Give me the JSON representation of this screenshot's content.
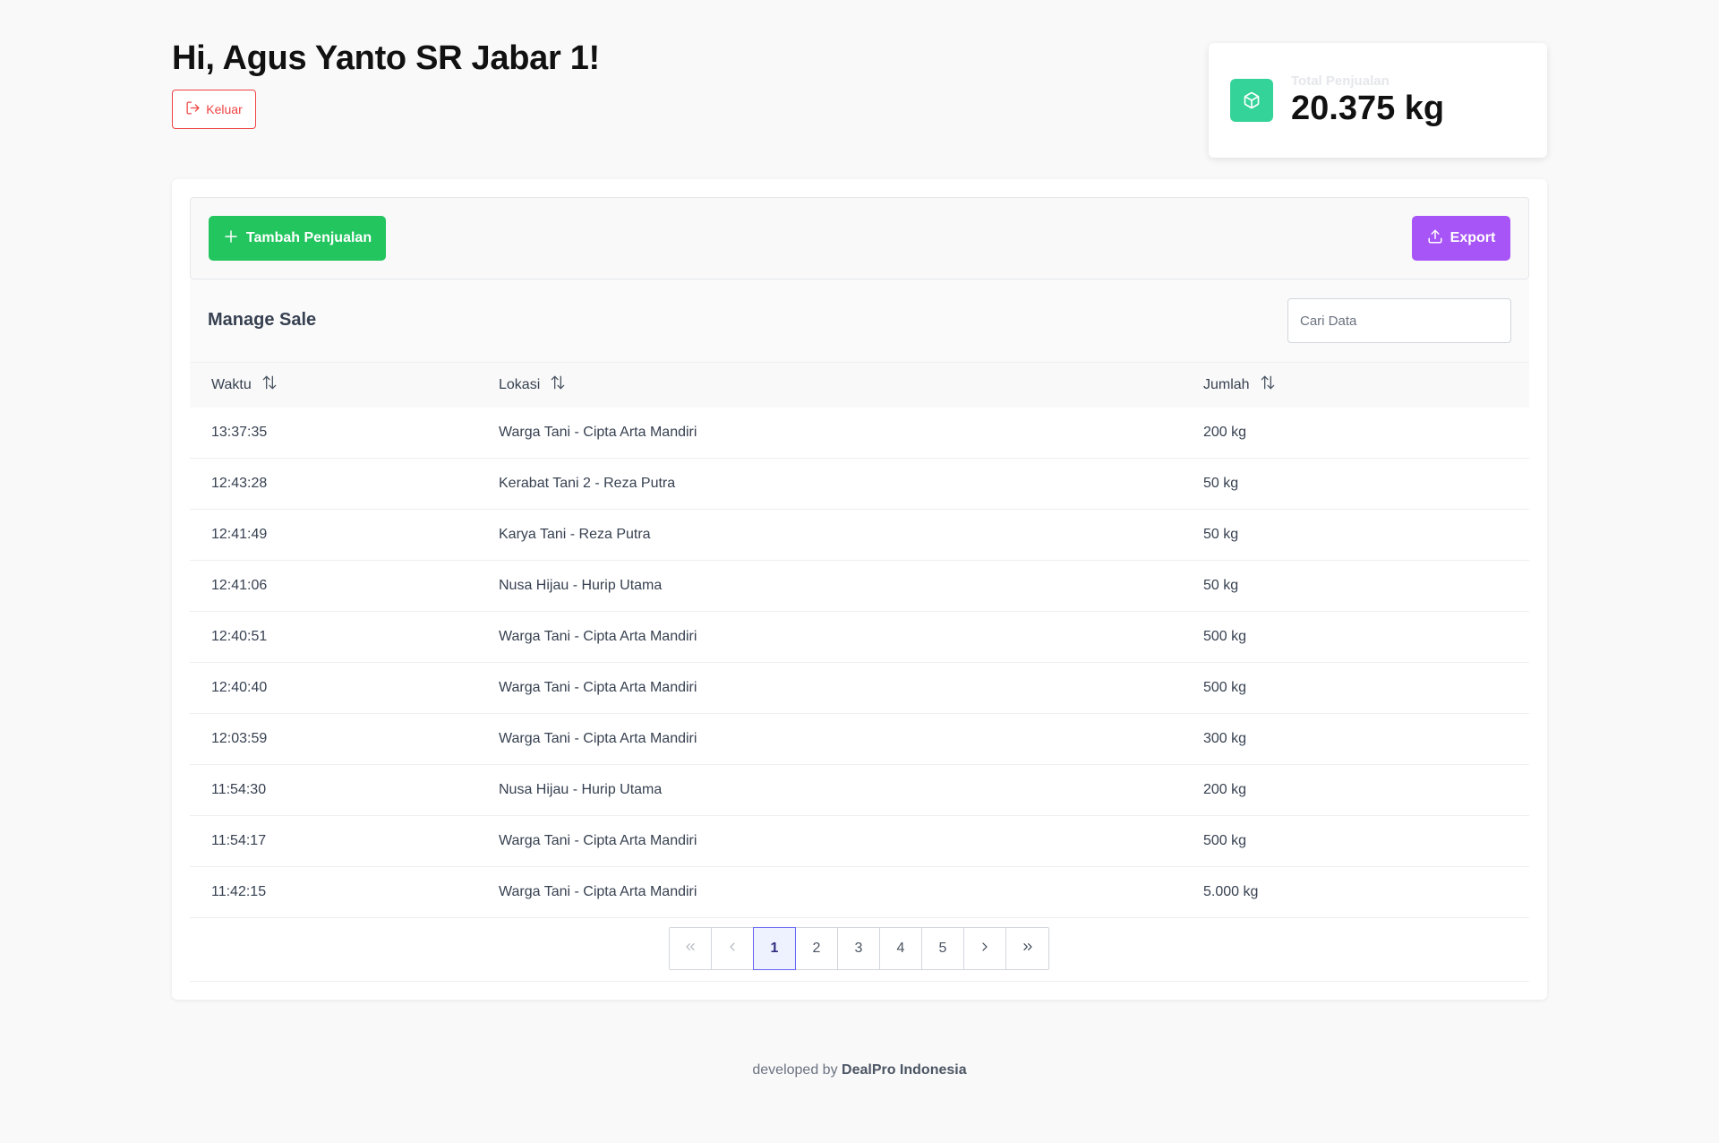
{
  "header": {
    "greeting": "Hi, Agus Yanto SR Jabar 1!",
    "logout_label": "Keluar"
  },
  "stats": {
    "label": "Total Penjualan",
    "value": "20.375 kg",
    "icon": "cube-icon",
    "accent_color": "#34d399"
  },
  "toolbar": {
    "add_label": "Tambah Penjualan",
    "export_label": "Export",
    "add_color": "#22c55e",
    "export_color": "#a855f7"
  },
  "table": {
    "title": "Manage Sale",
    "search_placeholder": "Cari Data",
    "columns": [
      "Waktu",
      "Lokasi",
      "Jumlah"
    ],
    "rows": [
      {
        "waktu": "13:37:35",
        "lokasi": "Warga Tani - Cipta Arta Mandiri",
        "jumlah": "200 kg"
      },
      {
        "waktu": "12:43:28",
        "lokasi": "Kerabat Tani 2 - Reza Putra",
        "jumlah": "50 kg"
      },
      {
        "waktu": "12:41:49",
        "lokasi": "Karya Tani - Reza Putra",
        "jumlah": "50 kg"
      },
      {
        "waktu": "12:41:06",
        "lokasi": "Nusa Hijau - Hurip Utama",
        "jumlah": "50 kg"
      },
      {
        "waktu": "12:40:51",
        "lokasi": "Warga Tani - Cipta Arta Mandiri",
        "jumlah": "500 kg"
      },
      {
        "waktu": "12:40:40",
        "lokasi": "Warga Tani - Cipta Arta Mandiri",
        "jumlah": "500 kg"
      },
      {
        "waktu": "12:03:59",
        "lokasi": "Warga Tani - Cipta Arta Mandiri",
        "jumlah": "300 kg"
      },
      {
        "waktu": "11:54:30",
        "lokasi": "Nusa Hijau - Hurip Utama",
        "jumlah": "200 kg"
      },
      {
        "waktu": "11:54:17",
        "lokasi": "Warga Tani - Cipta Arta Mandiri",
        "jumlah": "500 kg"
      },
      {
        "waktu": "11:42:15",
        "lokasi": "Warga Tani - Cipta Arta Mandiri",
        "jumlah": "5.000 kg"
      }
    ]
  },
  "pagination": {
    "pages": [
      "1",
      "2",
      "3",
      "4",
      "5"
    ],
    "current": "1"
  },
  "footer": {
    "prefix": "developed by",
    "company": "DealPro Indonesia"
  }
}
